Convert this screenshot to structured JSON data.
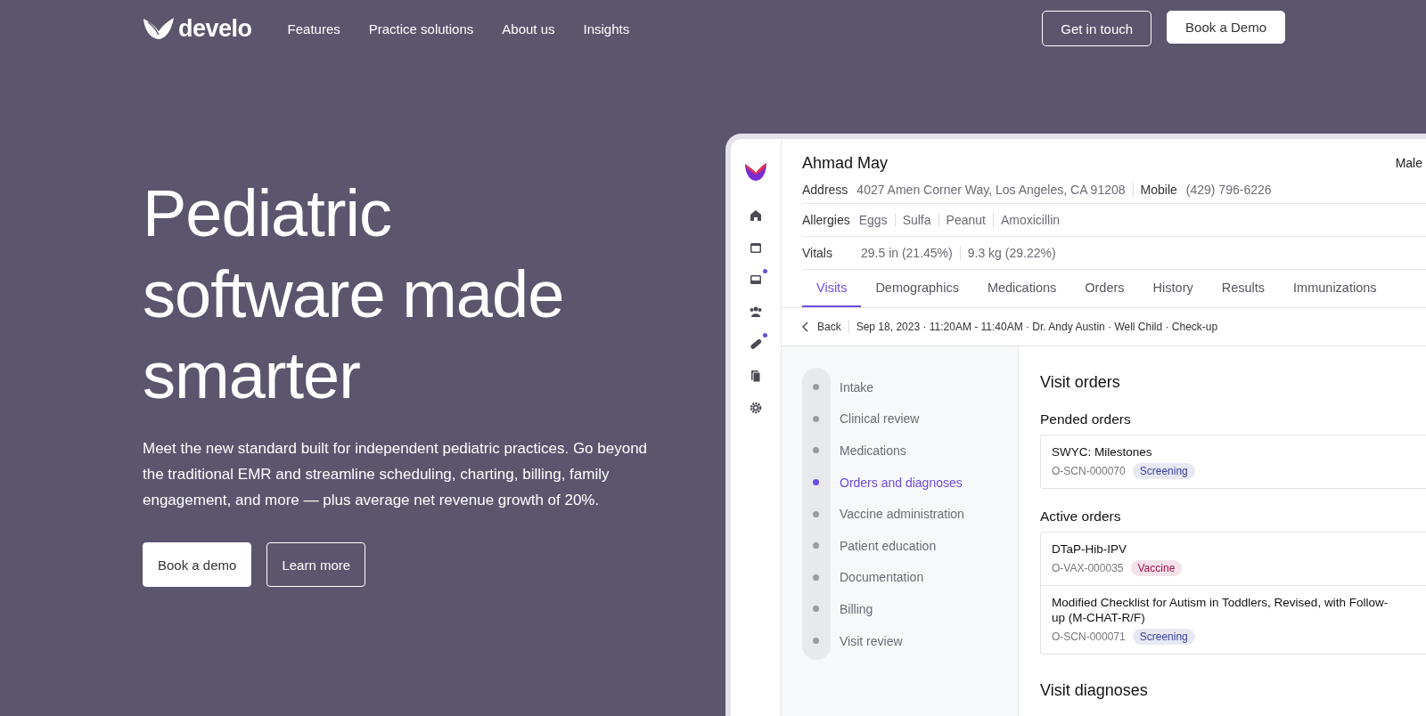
{
  "nav": {
    "brand": "develo",
    "links": [
      "Features",
      "Practice solutions",
      "About us",
      "Insights"
    ],
    "contact_button": "Get in touch",
    "demo_button": "Book a Demo"
  },
  "hero": {
    "headline": "Pediatric software made smarter",
    "body": "Meet the new standard built for independent pediatric practices. Go beyond the traditional EMR and streamline scheduling, charting, billing, family engagement, and more — plus average net revenue growth of 20%.",
    "primary_button": "Book a demo",
    "secondary_button": "Learn more"
  },
  "app": {
    "sidebar_icons": [
      {
        "kind": "home",
        "badge": false
      },
      {
        "kind": "calendar",
        "badge": false
      },
      {
        "kind": "inbox",
        "badge": true
      },
      {
        "kind": "people",
        "badge": false
      },
      {
        "kind": "bandage",
        "badge": true
      },
      {
        "kind": "documents",
        "badge": false
      },
      {
        "kind": "settings",
        "badge": false
      }
    ],
    "patient": {
      "name": "Ahmad May",
      "sex": "Male",
      "address_label": "Address",
      "address": "4027 Amen Corner Way, Los Angeles, CA 91208",
      "mobile_label": "Mobile",
      "mobile": "(429) 796-6226",
      "allergies_label": "Allergies",
      "allergies": [
        "Eggs",
        "Sulfa",
        "Peanut",
        "Amoxicillin"
      ],
      "vitals_label": "Vitals",
      "vitals": [
        "29.5 in (21.45%)",
        "9.3 kg (29.22%)"
      ]
    },
    "tabs": [
      {
        "label": "Visits",
        "selected": true
      },
      {
        "label": "Demographics",
        "selected": false
      },
      {
        "label": "Medications",
        "selected": false
      },
      {
        "label": "Orders",
        "selected": false
      },
      {
        "label": "History",
        "selected": false
      },
      {
        "label": "Results",
        "selected": false
      },
      {
        "label": "Immunizations",
        "selected": false
      }
    ],
    "breadcrumb": {
      "back": "Back",
      "visit": "Sep 18, 2023 · 11:20AM - 11:40AM · Dr. Andy Austin · Well Child · Check-up"
    },
    "steps": [
      {
        "label": "Intake",
        "selected": false
      },
      {
        "label": "Clinical review",
        "selected": false
      },
      {
        "label": "Medications",
        "selected": false
      },
      {
        "label": "Orders and diagnoses",
        "selected": true
      },
      {
        "label": "Vaccine administration",
        "selected": false
      },
      {
        "label": "Patient education",
        "selected": false
      },
      {
        "label": "Documentation",
        "selected": false
      },
      {
        "label": "Billing",
        "selected": false
      },
      {
        "label": "Visit review",
        "selected": false
      }
    ],
    "main": {
      "title": "Visit orders",
      "sections": [
        {
          "heading": "Pended orders",
          "orders": [
            {
              "name": "SWYC: Milestones",
              "code": "O-SCN-000070",
              "tag": {
                "label": "Screening",
                "color": "#3b3f9e"
              }
            }
          ]
        },
        {
          "heading": "Active orders",
          "orders": [
            {
              "name": "DTaP-Hib-IPV",
              "code": "O-VAX-000035",
              "tag": {
                "label": "Vaccine",
                "color": "#a3134f"
              }
            },
            {
              "name": "Modified Checklist for Autism in Toddlers, Revised, with Follow-up (M-CHAT-R/F)",
              "code": "O-SCN-000071",
              "tag": {
                "label": "Screening",
                "color": "#3b3f9e"
              }
            }
          ]
        }
      ],
      "diagnoses_title": "Visit diagnoses"
    }
  }
}
